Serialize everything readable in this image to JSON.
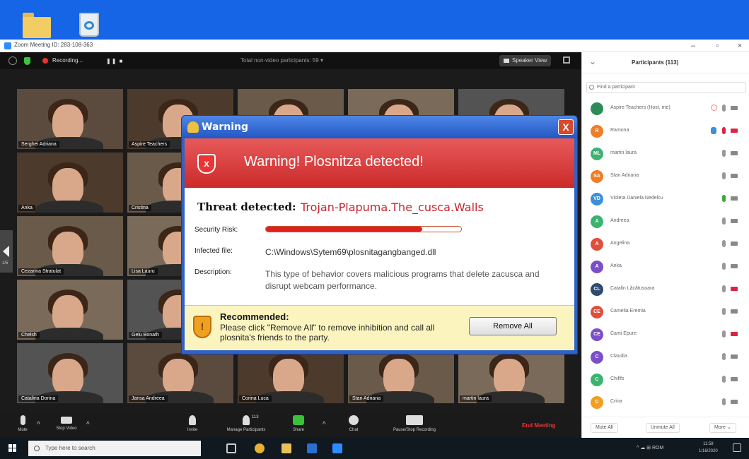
{
  "desktop": {
    "icons": [
      "folder-icon",
      "recycle-bin-icon"
    ]
  },
  "window": {
    "title": "Zoom Meeting ID: 283-108-363",
    "minimize": "–",
    "restore": "▫",
    "close": "×"
  },
  "meeting_bar": {
    "recording": "Recording...",
    "pause": "❚❚ ■",
    "total": "Total non-video participants: 59 ▾",
    "speaker_view": "Speaker View"
  },
  "tiles": [
    {
      "name": "Serghei Adriana"
    },
    {
      "name": "Aspire Teachers"
    },
    {
      "name": ""
    },
    {
      "name": ""
    },
    {
      "name": ""
    },
    {
      "name": "Anka"
    },
    {
      "name": "Cristina"
    },
    {
      "name": ""
    },
    {
      "name": ""
    },
    {
      "name": ""
    },
    {
      "name": "Cezarina Stratulat"
    },
    {
      "name": "Lisa Lauru"
    },
    {
      "name": ""
    },
    {
      "name": ""
    },
    {
      "name": ""
    },
    {
      "name": "Chelsh"
    },
    {
      "name": "Gelu Bonath"
    },
    {
      "name": ""
    },
    {
      "name": ""
    },
    {
      "name": ""
    },
    {
      "name": "Catalina Dorina"
    },
    {
      "name": "Jansa Andreea"
    },
    {
      "name": "Corina Luca"
    },
    {
      "name": "Stan Adriana"
    },
    {
      "name": "martin laura"
    }
  ],
  "page_indicator": "1/5",
  "toolbar": {
    "mute": "Mute",
    "stop_video": "Stop Video",
    "invite": "Invite",
    "manage": "Manage Participants",
    "manage_count": "113",
    "share": "Share",
    "chat": "Chat",
    "record": "Pause/Stop Recording",
    "end": "End Meeting",
    "caret": "^"
  },
  "panel": {
    "title": "Participants (113)",
    "chevron": "⌄",
    "search_placeholder": "Find a participant",
    "participants": [
      {
        "initials": "",
        "name": "Aspire Teachers (Host, me)",
        "color": "#2e8b57"
      },
      {
        "initials": "R",
        "name": "Ramona",
        "color": "#f07d28"
      },
      {
        "initials": "ML",
        "name": "martin laura",
        "color": "#3cb371"
      },
      {
        "initials": "SA",
        "name": "Stan Adriana",
        "color": "#f07d28"
      },
      {
        "initials": "VD",
        "name": "Violeta Daniela Nedelcu",
        "color": "#3d8fd8"
      },
      {
        "initials": "A",
        "name": "Andreea",
        "color": "#3cb371"
      },
      {
        "initials": "A",
        "name": "Angelina",
        "color": "#e04f3b"
      },
      {
        "initials": "A",
        "name": "Anka",
        "color": "#7b4fc9"
      },
      {
        "initials": "CL",
        "name": "Catalin Lăcătusoara",
        "color": "#2f4a6d"
      },
      {
        "initials": "CE",
        "name": "Camelia Eremia",
        "color": "#e04f3b"
      },
      {
        "initials": "CE",
        "name": "Cami Epure",
        "color": "#7b4fc9"
      },
      {
        "initials": "C",
        "name": "Claudia",
        "color": "#7b4fc9"
      },
      {
        "initials": "C",
        "name": "Chiflfs",
        "color": "#3cb371"
      },
      {
        "initials": "C",
        "name": "Crina",
        "color": "#f0a020"
      }
    ],
    "mute_all": "Mute All",
    "unmute_all": "Unmute All",
    "more": "More ⌄"
  },
  "taskbar": {
    "search_placeholder": "Type here to search",
    "tray": "^ ☁ ⊞ ROM",
    "time": "11:58",
    "date": "1/16/2020"
  },
  "dialog": {
    "title": "Warning",
    "close": "X",
    "banner": "Warning! Plosnitza detected!",
    "banner_icon": "x",
    "threat_label": "Threat detected:",
    "threat_name": "Trojan-Plapuma.The_cusca.Walls",
    "risk_label": "Security Risk:",
    "risk_level": 0.8,
    "file_label": "Infected file:",
    "file_value": "C:\\Windows\\Sytem69\\plosnitagangbanged.dll",
    "desc_label": "Description:",
    "desc_value": "This type of behavior covers malicious programs that delete zacusca and disrupt webcam performance.",
    "rec_icon": "!",
    "rec_title": "Recommended:",
    "rec_text": "Please click \"Remove All\" to remove inhibition and call all plosnita's friends to the party.",
    "remove_button": "Remove All"
  },
  "colors": {
    "desktop": "#1565e6",
    "danger": "#e02020",
    "zoom_bg": "#1f1f1f",
    "recommend_bg": "#fbf4bf"
  }
}
